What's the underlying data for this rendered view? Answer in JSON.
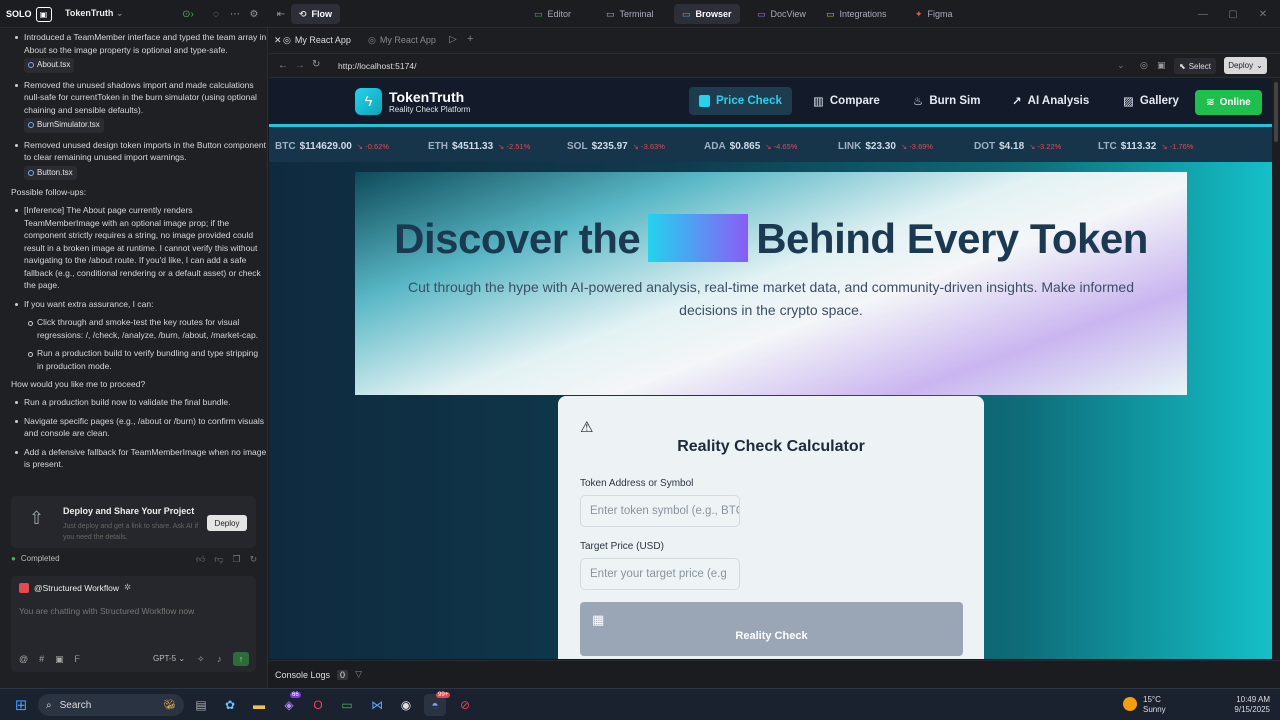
{
  "topbar": {
    "logo_text": "SOLO",
    "project_name": "TokenTruth",
    "flow_label": "Flow",
    "tabs": [
      {
        "label": "Editor",
        "icon": "code-icon",
        "color": "#3fb950"
      },
      {
        "label": "Terminal",
        "icon": "terminal-icon",
        "color": "#aaa"
      },
      {
        "label": "Browser",
        "icon": "browser-icon",
        "color": "#58a6ff"
      },
      {
        "label": "DocView",
        "icon": "doc-icon",
        "color": "#a371f7"
      },
      {
        "label": "Integrations",
        "icon": "puzzle-icon",
        "color": "#e3b341"
      },
      {
        "label": "Figma",
        "icon": "figma-icon",
        "color": "#f85149"
      }
    ]
  },
  "chat": {
    "items_top": [
      {
        "text": "Introduced a TeamMember interface and typed the team array in About so the image property is optional and type-safe.",
        "file": "About.tsx"
      },
      {
        "text": "Removed the unused shadows import and made calculations null-safe for currentToken in the burn simulator (using optional chaining and sensible defaults).",
        "file": "BurnSimulator.tsx"
      },
      {
        "text": "Removed unused design token imports in the Button component to clear remaining unused import warnings.",
        "file": "Button.tsx"
      }
    ],
    "followups_heading": "Possible follow-ups:",
    "followups": [
      "[Inference] The About page currently renders TeamMemberImage with an optional image prop; if the component strictly requires a string, no image provided could result in a broken image at runtime. I cannot verify this without navigating to the /about route. If you'd like, I can add a safe fallback (e.g., conditional rendering or a default asset) or check the page.",
      "If you want extra assurance, I can:"
    ],
    "sub_followups": [
      "Click through and smoke-test the key routes for visual regressions: /, /check, /analyze, /burn, /about, /market-cap.",
      "Run a production build to verify bundling and type stripping in production mode."
    ],
    "proceed_heading": "How would you like me to proceed?",
    "proceed": [
      "Run a production build now to validate the final bundle.",
      "Navigate specific pages (e.g., /about or /burn) to confirm visuals and console are clean.",
      "Add a defensive fallback for TeamMemberImage when no image is present."
    ],
    "deploy_title": "Deploy and Share Your Project",
    "deploy_desc": "Just deploy and get a link to share. Ask AI if you need the details.",
    "deploy_button": "Deploy",
    "status": "Completed",
    "agent_name": "@Structured Workflow",
    "input_placeholder": "You are chatting with Structured Workflow now",
    "model": "GPT-5"
  },
  "browser": {
    "tabs": [
      "My React App",
      "My React App"
    ],
    "url": "http://localhost:5174/",
    "select_label": "Select",
    "deploy_label": "Deploy",
    "console_label": "Console Logs",
    "console_count": "0"
  },
  "site": {
    "brand": "TokenTruth",
    "tagline": "Reality Check Platform",
    "nav": [
      {
        "label": "Price Check",
        "icon": "square-icon"
      },
      {
        "label": "Compare",
        "icon": "bar-chart-icon"
      },
      {
        "label": "Burn Sim",
        "icon": "flame-icon"
      },
      {
        "label": "AI Analysis",
        "icon": "trend-icon"
      },
      {
        "label": "Gallery",
        "icon": "image-icon"
      }
    ],
    "online_label": "Online",
    "ticker": [
      {
        "sym": "BTC",
        "price": "$114629.00",
        "chg": "-0.62%"
      },
      {
        "sym": "ETH",
        "price": "$4511.33",
        "chg": "-2.51%"
      },
      {
        "sym": "SOL",
        "price": "$235.97",
        "chg": "-3.63%"
      },
      {
        "sym": "ADA",
        "price": "$0.865",
        "chg": "-4.65%"
      },
      {
        "sym": "LINK",
        "price": "$23.30",
        "chg": "-3.69%"
      },
      {
        "sym": "DOT",
        "price": "$4.18",
        "chg": "-3.22%"
      },
      {
        "sym": "LTC",
        "price": "$113.32",
        "chg": "-1.76%"
      }
    ],
    "hero_title_left": "Discover the",
    "hero_title_right": "Behind Every Token",
    "hero_sub": "Cut through the hype with AI-powered analysis, real-time market data, and community-driven insights. Make informed decisions in the crypto space.",
    "card_title": "Reality Check Calculator",
    "token_label": "Token Address or Symbol",
    "token_placeholder": "Enter token symbol (e.g., BTC",
    "target_label": "Target Price (USD)",
    "target_placeholder": "Enter your target price (e.g",
    "check_button": "Reality Check"
  },
  "taskbar": {
    "search": "Search",
    "weather_temp": "15°C",
    "weather_desc": "Sunny",
    "time": "10:49 AM",
    "date": "9/15/2025",
    "badge1": "66",
    "badge2": "99+"
  }
}
